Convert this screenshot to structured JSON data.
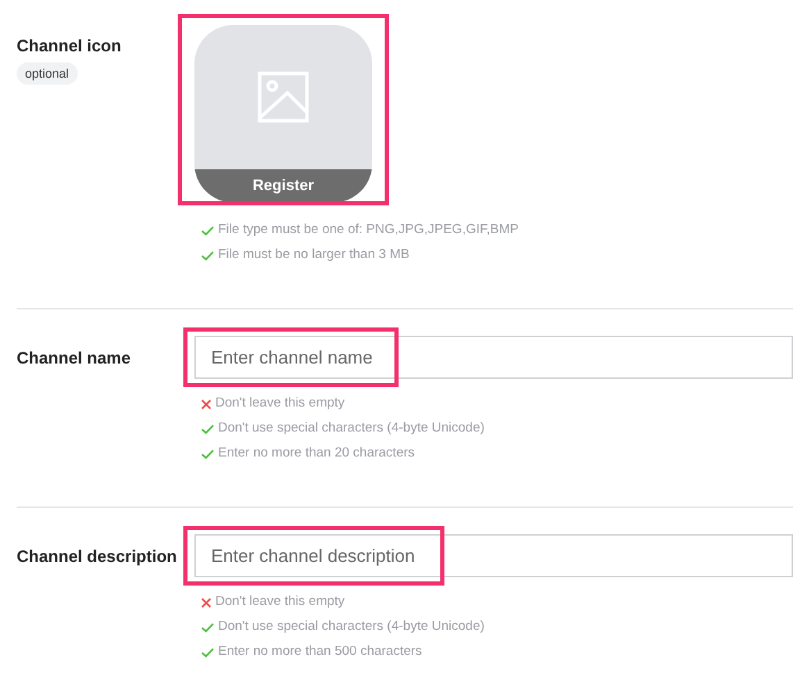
{
  "fields": [
    {
      "kind": "icon",
      "label": "Channel icon",
      "badge": "optional",
      "button": "Register",
      "highlighted": true,
      "rules": [
        {
          "text": "File type must be one of: PNG,JPG,JPEG,GIF,BMP",
          "passed": true
        },
        {
          "text": "File must be no larger than 3 MB",
          "passed": true
        }
      ]
    },
    {
      "kind": "text",
      "label": "Channel name",
      "placeholder": "Enter channel name",
      "highlighted": true,
      "rules": [
        {
          "text": "Don't leave this empty",
          "passed": false
        },
        {
          "text": "Don't use special characters (4-byte Unicode)",
          "passed": true
        },
        {
          "text": "Enter no more than 20 characters",
          "passed": true
        }
      ]
    },
    {
      "kind": "text",
      "label": "Channel description",
      "placeholder": "Enter channel description",
      "highlighted": true,
      "rules": [
        {
          "text": "Don't leave this empty",
          "passed": false
        },
        {
          "text": "Don't use special characters (4-byte Unicode)",
          "passed": true
        },
        {
          "text": "Enter no more than 500 characters",
          "passed": true
        }
      ]
    }
  ]
}
